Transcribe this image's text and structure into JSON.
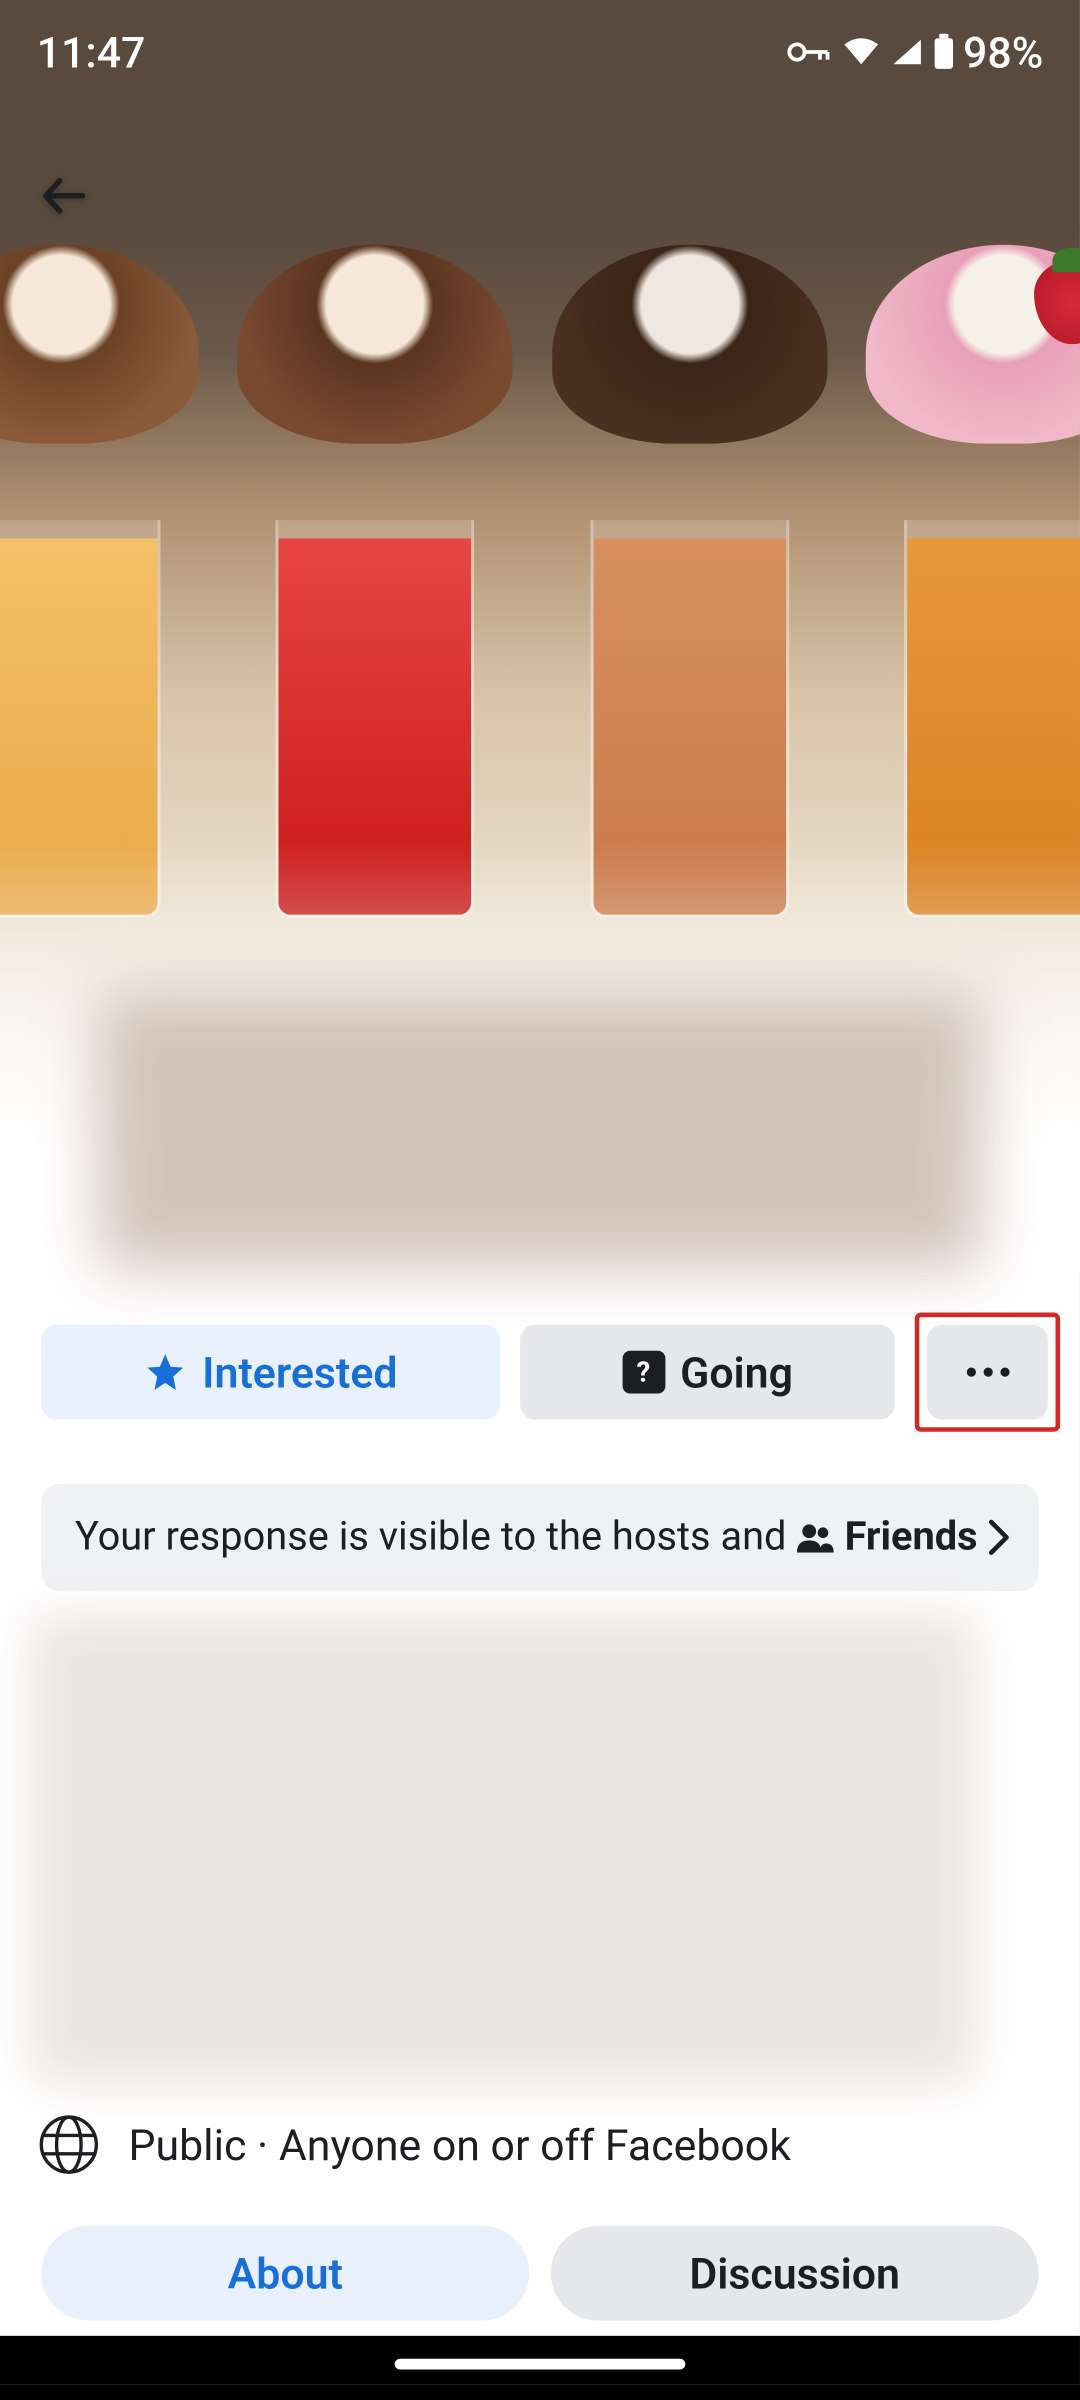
{
  "statusbar": {
    "time": "11:47",
    "battery": "98%"
  },
  "actions": {
    "interested": "Interested",
    "going": "Going"
  },
  "visibility": {
    "prefix": "Your response is visible to the hosts and",
    "audience": "Friends"
  },
  "privacy": {
    "text": "Public · Anyone on or off Facebook"
  },
  "tabs": {
    "about": "About",
    "discussion": "Discussion"
  },
  "highlight": {
    "target": "more-options-button"
  },
  "colors": {
    "accent": "#1a6ed8",
    "highlight_ring": "#d32828",
    "secondary_bg": "#e6e7ea",
    "primary_light_bg": "#e7f0fb"
  }
}
